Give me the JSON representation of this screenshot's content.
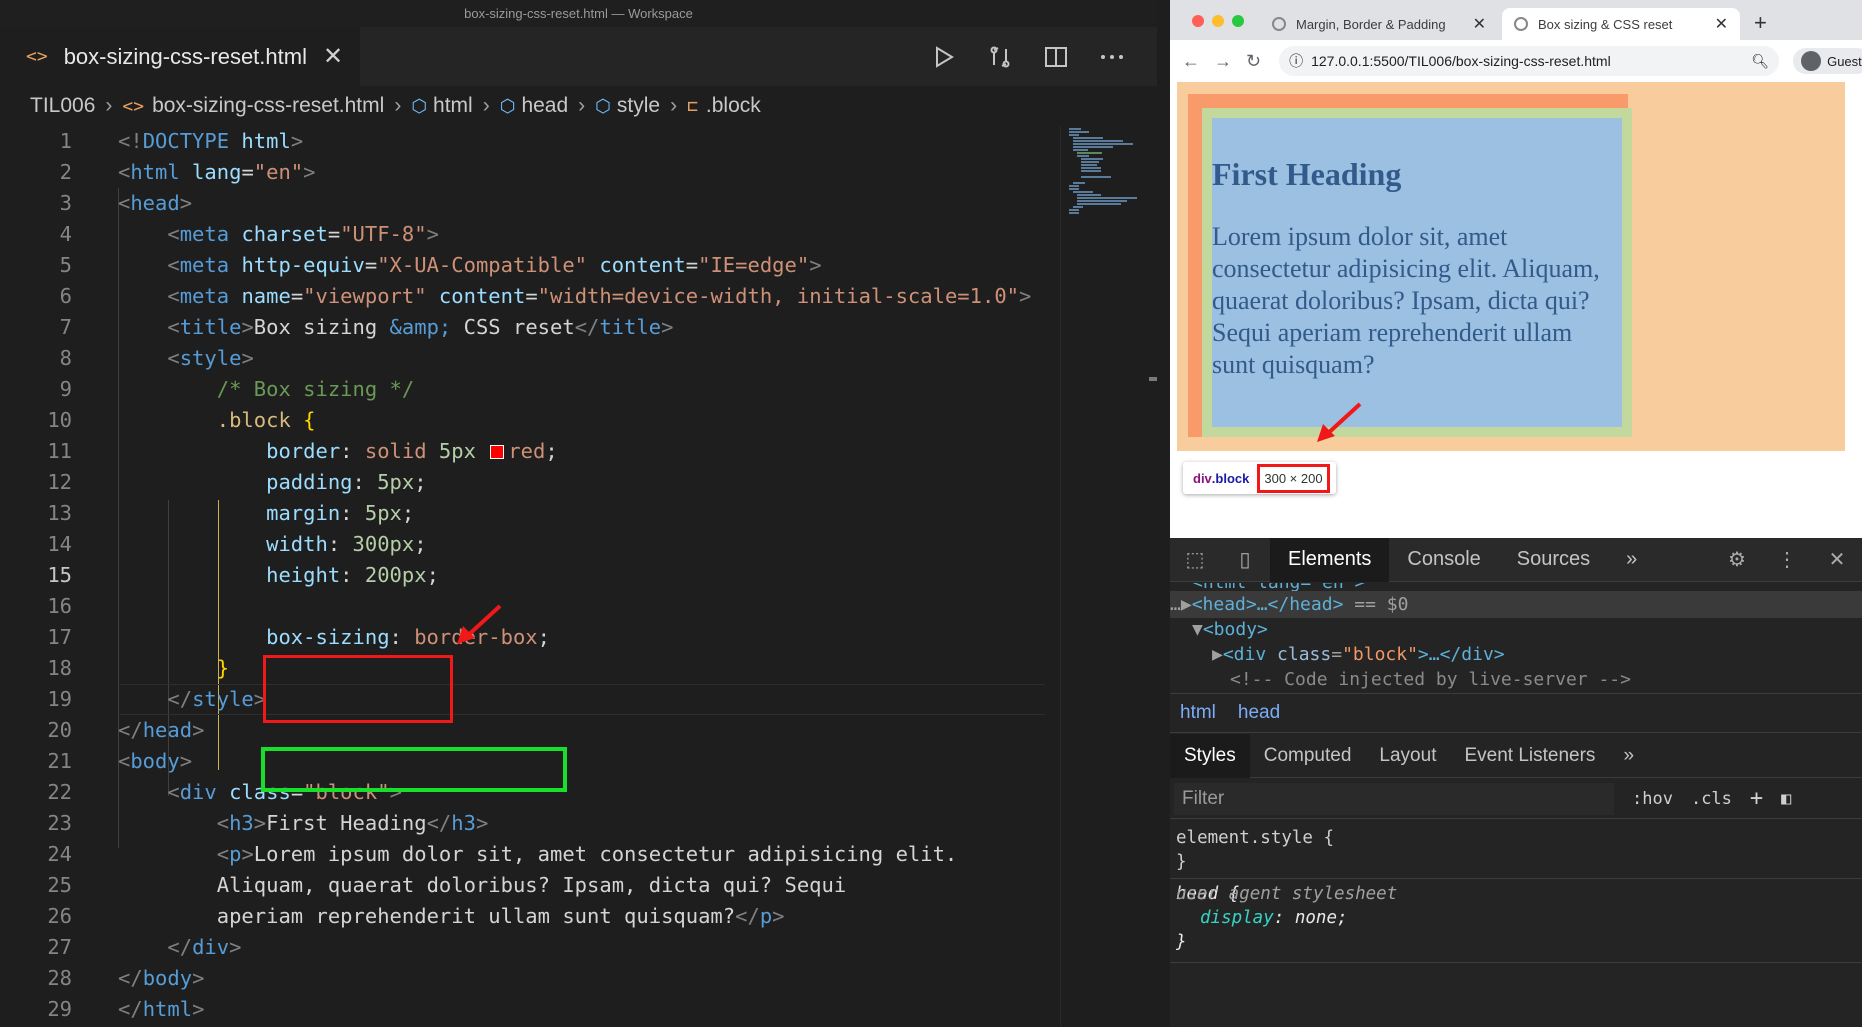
{
  "window_title": "box-sizing-css-reset.html — Workspace",
  "editor": {
    "tab_label": "box-sizing-css-reset.html",
    "breadcrumb": [
      "TIL006",
      "box-sizing-css-reset.html",
      "html",
      "head",
      "style",
      ".block"
    ],
    "lines": [
      {
        "n": "1"
      },
      {
        "n": "2"
      },
      {
        "n": "3"
      },
      {
        "n": "4"
      },
      {
        "n": "5"
      },
      {
        "n": "6"
      },
      {
        "n": "7"
      },
      {
        "n": "8"
      },
      {
        "n": "9"
      },
      {
        "n": "10"
      },
      {
        "n": "11"
      },
      {
        "n": "12"
      },
      {
        "n": "13"
      },
      {
        "n": "14"
      },
      {
        "n": "15"
      },
      {
        "n": "16"
      },
      {
        "n": "17"
      },
      {
        "n": "18"
      },
      {
        "n": "19"
      },
      {
        "n": "20"
      },
      {
        "n": "21"
      },
      {
        "n": "22"
      },
      {
        "n": "23"
      },
      {
        "n": "24"
      },
      {
        "n": "25"
      },
      {
        "n": "26"
      },
      {
        "n": "27"
      },
      {
        "n": "28"
      },
      {
        "n": "29"
      }
    ],
    "code": {
      "l1a": "<!",
      "l1b": "DOCTYPE",
      "l1c": " html",
      ">": ">",
      "l2": "html",
      "l2attr": " lang",
      "l2val": "\"en\"",
      "l3": "head",
      "l4attr": "charset",
      "l4val": "\"UTF-8\"",
      "l5attr1": "http-equiv",
      "l5val1": "\"X-UA-Compatible\"",
      "l5attr2": "content",
      "l5val2": "\"IE=edge\"",
      "l6attr1": "name",
      "l6val1": "\"viewport\"",
      "l6attr2": "content",
      "l6val2": "\"width=device-width, initial-scale=1.0\"",
      "l7text1": "Box sizing ",
      "l7ent": "&amp;",
      "l7text2": " CSS reset",
      "l9": "/* Box sizing */",
      "l10": ".block",
      "l11p": "border",
      "l11v1": "solid ",
      "l11n": "5px",
      "l11v2": "red",
      "l12p": "padding",
      "l12n": "5px",
      "l13p": "margin",
      "l13n": "5px",
      "l14p": "width",
      "l14n": "300px",
      "l15p": "height",
      "l15n": "200px",
      "l17p": "box-sizing",
      "l17v": "border-box",
      "l22attr": "class",
      "l22val": "\"block\"",
      "l23": "First Heading",
      "l24": "Lorem ipsum dolor sit, amet consectetur adipisicing elit.",
      "l25": "Aliquam, quaerat doloribus? Ipsam, dicta qui? Sequi",
      "l26": "aperiam reprehenderit ullam sunt quisquam?"
    }
  },
  "browser": {
    "tabs": [
      {
        "label": "Margin, Border & Padding"
      },
      {
        "label": "Box sizing & CSS reset"
      }
    ],
    "url": "127.0.0.1:5500/TIL006/box-sizing-css-reset.html",
    "profile": "Guest",
    "page": {
      "heading": "First Heading",
      "paragraph": "Lorem ipsum dolor sit, amet consectetur adipisicing elit. Aliquam, quaerat doloribus? Ipsam, dicta qui? Sequi aperiam reprehenderit ullam sunt quisquam?"
    },
    "tooltip": {
      "tag": "div",
      "cls": ".block",
      "size": "300 × 200"
    }
  },
  "devtools": {
    "tabs": [
      "Elements",
      "Console",
      "Sources"
    ],
    "dom": {
      "l0": "<html lang=\"en\">",
      "head": "<head>…</head>",
      "eq": " == $0",
      "body": "<body>",
      "div_open": "<div ",
      "div_attr": "class",
      "div_val": "\"block\"",
      "div_close": ">…</div>",
      "comment": "<!-- Code injected by live-server -->"
    },
    "path": [
      "html",
      "head"
    ],
    "style_tabs": [
      "Styles",
      "Computed",
      "Layout",
      "Event Listeners"
    ],
    "filter_placeholder": "Filter",
    "hov": ":hov",
    "cls": ".cls",
    "rule1_sel": "element.style {",
    "rule1_end": "}",
    "rule2_sel": "head {",
    "rule2_src": "user agent stylesheet",
    "rule2_prop": "display",
    "rule2_val": "none;",
    "rule2_end": "}"
  }
}
